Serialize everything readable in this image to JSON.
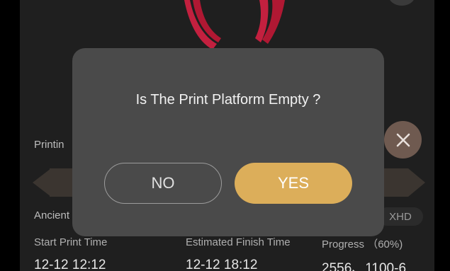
{
  "background": {
    "printing_label": "Printin",
    "file_name": "Ancient",
    "quality": "XHD",
    "stats": [
      {
        "label": "Start Print Time",
        "value": "12-12 12:12"
      },
      {
        "label": "Estimated Finish Time",
        "value": "12-12 18:12"
      },
      {
        "label": "Progress （60%)",
        "value": "2556、1100-6"
      }
    ]
  },
  "dialog": {
    "message": "Is The Print Platform Empty ?",
    "no_label": "NO",
    "yes_label": "YES"
  },
  "colors": {
    "dialog_bg": "#4a4a4a",
    "yes_button": "#dcae5a",
    "close_button": "#6f5a50"
  },
  "icons": {
    "close": "close-icon",
    "model_preview": "model-preview-icon"
  }
}
